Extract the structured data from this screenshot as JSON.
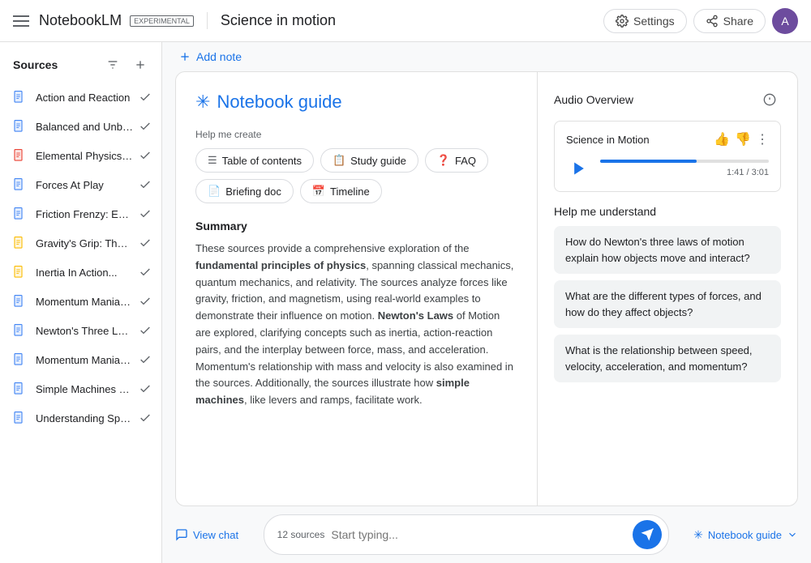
{
  "header": {
    "app_name": "NotebookLM",
    "experimental_label": "EXPERIMENTAL",
    "notebook_title": "Science in motion",
    "settings_label": "Settings",
    "share_label": "Share",
    "avatar_initial": "A"
  },
  "sidebar": {
    "title": "Sources",
    "sources": [
      {
        "id": 1,
        "label": "Action and Reaction",
        "icon_type": "blue"
      },
      {
        "id": 2,
        "label": "Balanced and Unbalance...",
        "icon_type": "blue"
      },
      {
        "id": 3,
        "label": "Elemental Physics, Third...",
        "icon_type": "red"
      },
      {
        "id": 4,
        "label": "Forces At Play",
        "icon_type": "blue"
      },
      {
        "id": 5,
        "label": "Friction Frenzy: Explorin...",
        "icon_type": "blue"
      },
      {
        "id": 6,
        "label": "Gravity's Grip: The Force...",
        "icon_type": "yellow"
      },
      {
        "id": 7,
        "label": "Inertia In Action...",
        "icon_type": "yellow"
      },
      {
        "id": 8,
        "label": "Momentum Mania: Inves...",
        "icon_type": "blue"
      },
      {
        "id": 9,
        "label": "Newton's Three Laws...",
        "icon_type": "blue"
      },
      {
        "id": 10,
        "label": "Momentum Mania: Inves...",
        "icon_type": "blue"
      },
      {
        "id": 11,
        "label": "Simple Machines Make...",
        "icon_type": "blue"
      },
      {
        "id": 12,
        "label": "Understanding Speed, Ve...",
        "icon_type": "blue"
      }
    ]
  },
  "toolbar": {
    "add_note_label": "Add note"
  },
  "notebook_guide": {
    "title": "Notebook guide",
    "help_create_label": "Help me create",
    "chips": [
      {
        "label": "Table of contents",
        "icon": "☰"
      },
      {
        "label": "Study guide",
        "icon": "📋"
      },
      {
        "label": "FAQ",
        "icon": "❓"
      },
      {
        "label": "Briefing doc",
        "icon": "📄"
      },
      {
        "label": "Timeline",
        "icon": "📅"
      }
    ],
    "summary_title": "Summary",
    "summary_text": "These sources provide a comprehensive exploration of the fundamental principles of physics, spanning classical mechanics, quantum mechanics, and relativity. The sources analyze forces like gravity, friction, and magnetism, using real-world examples to demonstrate their influence on motion. Newton's Laws of Motion are explored, clarifying concepts such as inertia, action-reaction pairs, and the interplay between force, mass, and acceleration. Momentum's relationship with mass and velocity is also examined in the sources. Additionally, the sources illustrate how simple machines, like levers and ramps, facilitate work.",
    "bold_phrases": [
      "fundamental principles of physics",
      "Newton's Laws",
      "simple machines"
    ]
  },
  "audio_overview": {
    "section_title": "Audio Overview",
    "track_title": "Science in Motion",
    "time_current": "1:41",
    "time_total": "3:01",
    "time_label": "1:41 / 3:01",
    "progress_percent": 57
  },
  "help_understand": {
    "title": "Help me understand",
    "questions": [
      "How do Newton's three laws of motion explain how objects move and interact?",
      "What are the different types of forces, and how do they affect objects?",
      "What is the relationship between speed, velocity, acceleration, and momentum?"
    ]
  },
  "bottom_bar": {
    "view_chat_label": "View chat",
    "sources_count_label": "12 sources",
    "input_placeholder": "Start typing...",
    "notebook_guide_tab_label": "Notebook guide"
  }
}
